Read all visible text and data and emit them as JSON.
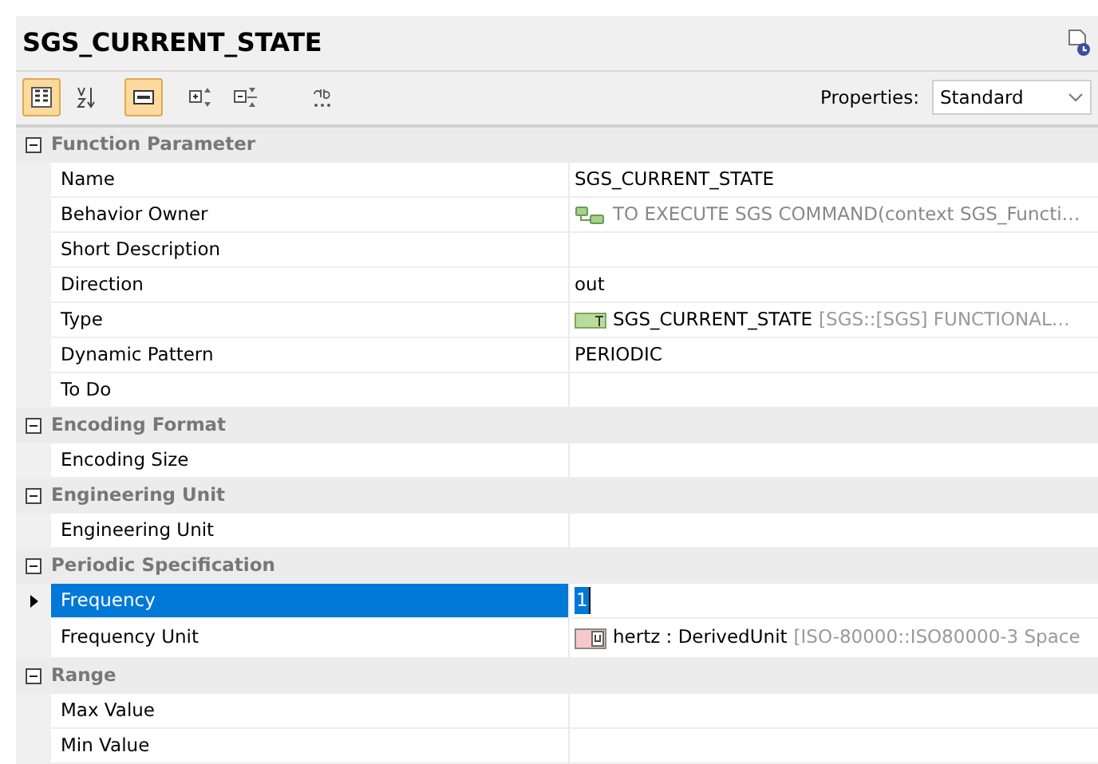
{
  "title": "SGS_CURRENT_STATE",
  "toolbar": [
    {
      "kind": "categorized",
      "pressed": true
    },
    {
      "kind": "alphabetical",
      "pressed": false
    },
    {
      "kind": "description",
      "pressed": true
    },
    {
      "kind": "expand-all",
      "pressed": false
    },
    {
      "kind": "collapse-all",
      "pressed": false
    },
    {
      "kind": "find",
      "pressed": false
    }
  ],
  "properties_filter": {
    "label": "Properties:",
    "value": "Standard"
  },
  "groups": [
    {
      "title": "Function Parameter",
      "expanded": true,
      "rows": [
        {
          "name": "Name",
          "value": "SGS_CURRENT_STATE",
          "selected": false
        },
        {
          "name": "Behavior Owner",
          "value": "TO EXECUTE SGS COMMAND(context SGS_Functi…",
          "kind": "relation",
          "muted": true,
          "selected": false
        },
        {
          "name": "Short Description",
          "selected": false
        },
        {
          "name": "Direction",
          "value": "out",
          "selected": false
        },
        {
          "name": "Type",
          "value": "SGS_CURRENT_STATE",
          "detail": "[SGS::[SGS] FUNCTIONAL…",
          "kind": "type",
          "selected": false
        },
        {
          "name": "Dynamic Pattern",
          "value": "PERIODIC",
          "selected": false
        },
        {
          "name": "To Do",
          "selected": false
        }
      ]
    },
    {
      "title": "Encoding Format",
      "expanded": true,
      "rows": [
        {
          "name": "Encoding Size",
          "selected": false
        }
      ]
    },
    {
      "title": "Engineering Unit",
      "expanded": true,
      "rows": [
        {
          "name": "Engineering Unit",
          "selected": false
        }
      ]
    },
    {
      "title": "Periodic Specification",
      "expanded": true,
      "rows": [
        {
          "name": "Frequency",
          "value": "1",
          "selected": true
        },
        {
          "name": "Frequency Unit",
          "value": "hertz : DerivedUnit",
          "detail": "[ISO-80000::ISO80000-3 Space",
          "kind": "unit",
          "selected": false
        }
      ]
    },
    {
      "title": "Range",
      "expanded": true,
      "rows": [
        {
          "name": "Max Value",
          "selected": false
        },
        {
          "name": "Min Value",
          "selected": false
        }
      ]
    }
  ]
}
